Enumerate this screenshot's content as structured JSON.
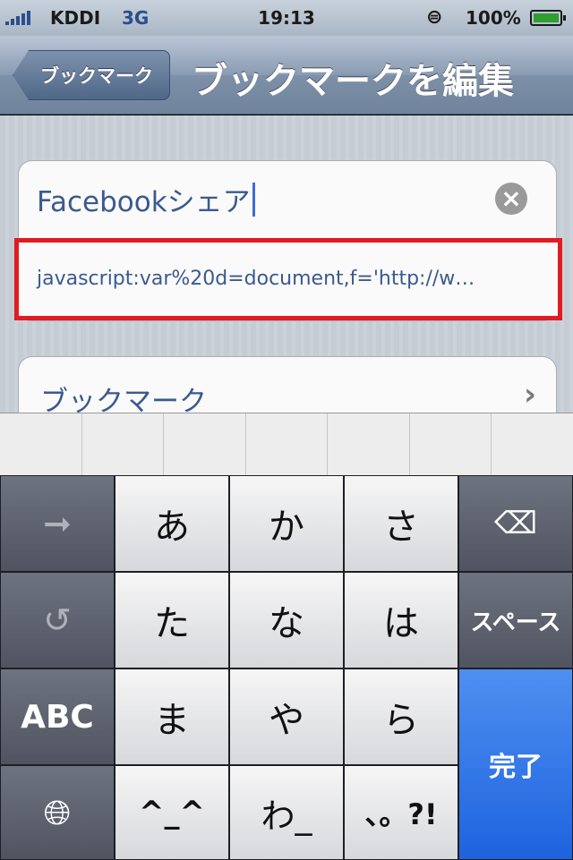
{
  "status": {
    "carrier": "KDDI",
    "network": "3G",
    "time": "19:13",
    "battery": "100%"
  },
  "nav": {
    "back_label": "ブックマーク",
    "title": "ブックマークを編集"
  },
  "form": {
    "title_value": "Facebookシェア",
    "url_value": "javascript:var%20d=document,f='http://w…",
    "folder_label": "ブックマーク"
  },
  "keyboard": {
    "row1": [
      "あ",
      "か",
      "さ"
    ],
    "row2": [
      "た",
      "な",
      "は"
    ],
    "row3": [
      "ま",
      "や",
      "ら"
    ],
    "row4": [
      "^_^",
      "わ_",
      "、。?!"
    ],
    "abc": "ABC",
    "space": "スペース",
    "done": "完了"
  },
  "colors": {
    "highlight": "#e11b22",
    "done_key": "#1d63de"
  }
}
